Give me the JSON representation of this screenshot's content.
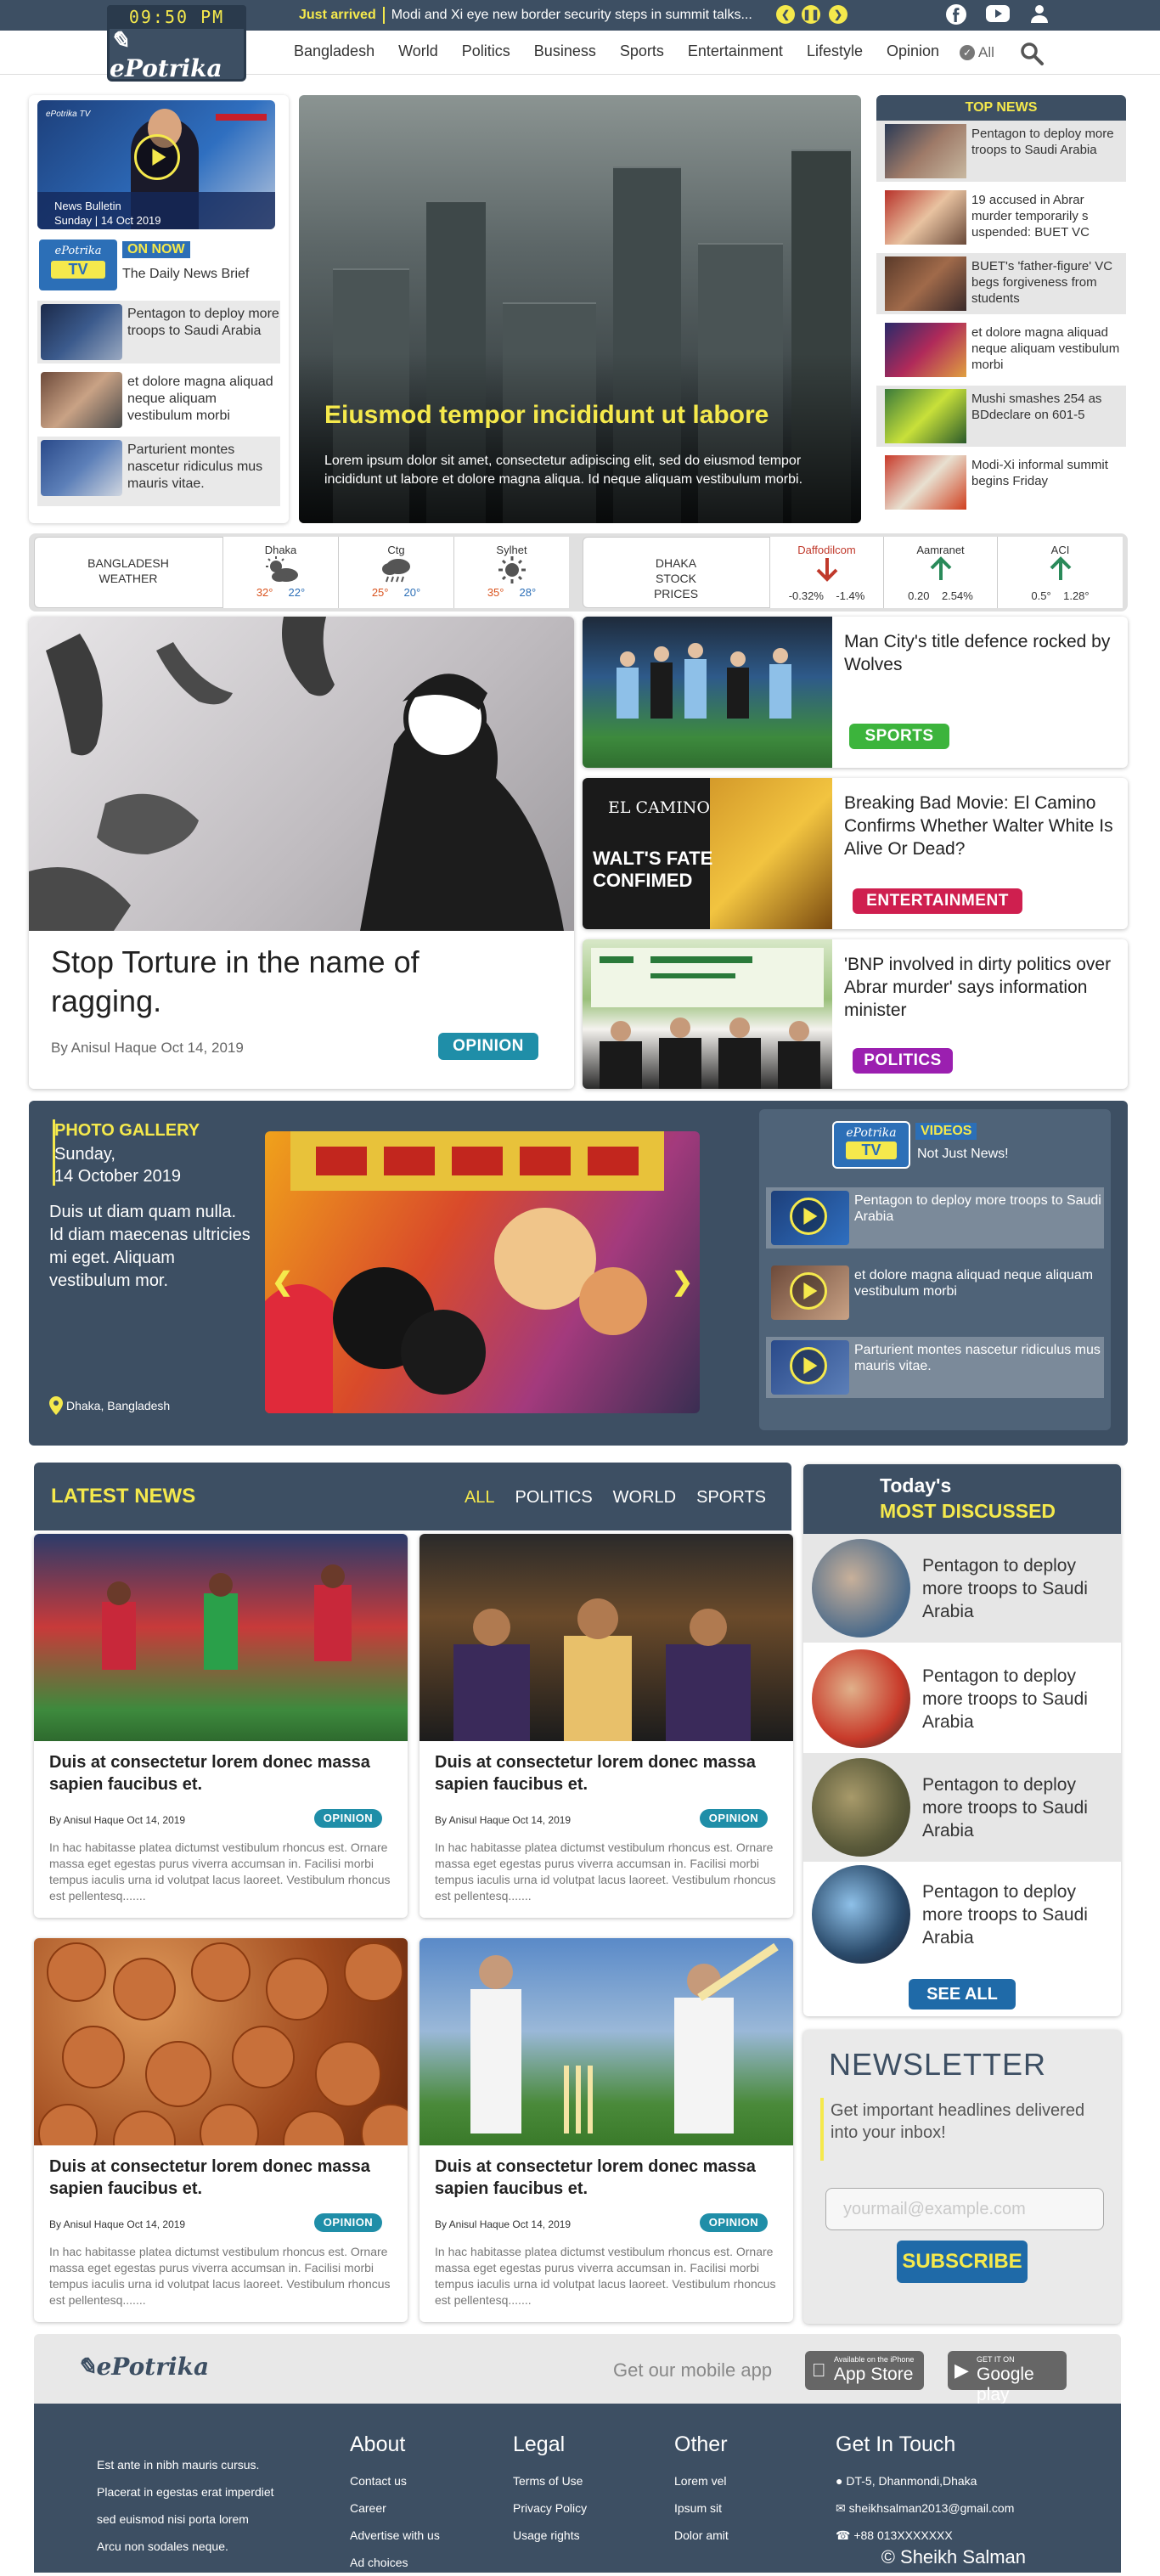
{
  "clock": "09:50 PM",
  "brand": "ePotrika",
  "ticker": {
    "label": "Just arrived",
    "text": "Modi and Xi eye new border security steps in summit talks..."
  },
  "nav": [
    "Bangladesh",
    "World",
    "Politics",
    "Business",
    "Sports",
    "Entertainment",
    "Lifestyle",
    "Opinion"
  ],
  "nav_all": "All",
  "tv": {
    "caption1": "News Bulletin",
    "caption2": "Sunday | 14 Oct 2019",
    "logo_small": "ePotrika TV",
    "badge_l1": "ePotrika",
    "badge_l2": "TV",
    "on_now": "ON NOW",
    "brief": "The Daily News Brief"
  },
  "left_stories": [
    "Pentagon to deploy more troops to Saudi Arabia",
    "et dolore magna aliquad neque aliquam vestibulum morbi",
    "Parturient montes nascetur ridiculus mus mauris vitae."
  ],
  "hero": {
    "title": "Eiusmod tempor incididunt ut labore",
    "desc": "Lorem ipsum dolor sit amet, consectetur adipiscing elit, sed do eiusmod tempor incididunt ut labore et dolore magna aliqua. Id neque aliquam vestibulum morbi."
  },
  "top_news": {
    "heading": "TOP NEWS",
    "items": [
      "Pentagon to deploy more troops to Saudi Arabia",
      "19 accused in Abrar murder temporarily s uspended: BUET VC",
      "BUET's 'father-figure' VC begs forgiveness from students",
      "et dolore magna aliquad neque aliquam vestibulum morbi",
      "Mushi smashes 254 as BDdeclare on 601-5",
      "Modi-Xi informal summit begins Friday"
    ]
  },
  "weather": {
    "label": "BANGLADESH WEATHER",
    "cities": [
      {
        "name": "Dhaka",
        "hi": "32°",
        "lo": "22°",
        "icon": "cloud-sun-icon"
      },
      {
        "name": "Ctg",
        "hi": "25°",
        "lo": "20°",
        "icon": "rain-cloud-icon"
      },
      {
        "name": "Sylhet",
        "hi": "35°",
        "lo": "28°",
        "icon": "sun-icon"
      }
    ]
  },
  "stocks": {
    "label": "DHAKA STOCK PRICES",
    "items": [
      {
        "name": "Daffodilcom",
        "change": "-0.32%",
        "pct": "-1.4%",
        "dir": "down",
        "color": "#c0392b"
      },
      {
        "name": "Aamranet",
        "change": "0.20",
        "pct": "2.54%",
        "dir": "up",
        "color": "#2a8a5a"
      },
      {
        "name": "ACI",
        "change": "0.5°",
        "pct": "1.28°",
        "dir": "up",
        "color": "#2a8a5a"
      }
    ]
  },
  "feature": {
    "title": "Stop Torture in the name of ragging.",
    "byline": "By Anisul Haque Oct 14, 2019",
    "tag": "OPINION"
  },
  "side_cards": [
    {
      "title": "Man City's title defence rocked by Wolves",
      "tag": "SPORTS"
    },
    {
      "title": "Breaking Bad Movie: El Camino Confirms Whether Walter White Is Alive Or Dead?",
      "tag": "ENTERTAINMENT"
    },
    {
      "title": "'BNP involved in dirty politics over Abrar murder' says information minister",
      "tag": "POLITICS"
    }
  ],
  "elcamino": {
    "l1": "EL CAMINO",
    "l2": "WALT'S FATE",
    "l3": "CONFIMED"
  },
  "gallery": {
    "heading": "PHOTO GALLERY",
    "date1": "Sunday,",
    "date2": "14 October 2019",
    "desc": "Duis ut diam quam nulla. Id diam maecenas ultricies mi eget. Aliquam vestibulum mor.",
    "location": "Dhaka, Bangladesh"
  },
  "videos": {
    "logo1": "ePotrika",
    "logo2": "TV",
    "heading": "VIDEOS",
    "sub": "Not Just News!",
    "items": [
      "Pentagon to deploy more troops to Saudi Arabia",
      "et dolore magna aliquad neque aliquam vestibulum morbi",
      "Parturient montes nascetur ridiculus mus mauris vitae."
    ]
  },
  "latest": {
    "heading": "LATEST NEWS",
    "tabs": [
      "ALL",
      "POLITICS",
      "WORLD",
      "SPORTS"
    ],
    "cards": [
      {
        "title": "Duis at consectetur lorem donec massa sapien faucibus et.",
        "byline": "By Anisul Haque Oct 14, 2019",
        "tag": "OPINION",
        "excerpt": "In hac habitasse platea dictumst vestibulum rhoncus est. Ornare massa eget egestas purus viverra accumsan in. Facilisi morbi tempus iaculis urna id volutpat lacus laoreet. Vestibulum rhoncus est pellentesq......."
      },
      {
        "title": "Duis at consectetur lorem donec massa sapien faucibus et.",
        "byline": "By Anisul Haque Oct 14, 2019",
        "tag": "OPINION",
        "excerpt": "In hac habitasse platea dictumst vestibulum rhoncus est. Ornare massa eget egestas purus viverra accumsan in. Facilisi morbi tempus iaculis urna id volutpat lacus laoreet. Vestibulum rhoncus est pellentesq......."
      },
      {
        "title": "Duis at consectetur lorem donec massa sapien faucibus et.",
        "byline": "By Anisul Haque Oct 14, 2019",
        "tag": "OPINION",
        "excerpt": "In hac habitasse platea dictumst vestibulum rhoncus est. Ornare massa eget egestas purus viverra accumsan in. Facilisi morbi tempus iaculis urna id volutpat lacus laoreet. Vestibulum rhoncus est pellentesq......."
      },
      {
        "title": "Duis at consectetur lorem donec massa sapien faucibus et.",
        "byline": "By Anisul Haque Oct 14, 2019",
        "tag": "OPINION",
        "excerpt": "In hac habitasse platea dictumst vestibulum rhoncus est. Ornare massa eget egestas purus viverra accumsan in. Facilisi morbi tempus iaculis urna id volutpat lacus laoreet. Vestibulum rhoncus est pellentesq......."
      }
    ]
  },
  "most_discussed": {
    "l1": "Today's",
    "l2": "MOST DISCUSSED",
    "items": [
      "Pentagon to deploy more troops to Saudi Arabia",
      "Pentagon to deploy more troops to Saudi Arabia",
      "Pentagon to deploy more troops to Saudi Arabia",
      "Pentagon to deploy more troops to Saudi Arabia"
    ],
    "see_all": "SEE ALL"
  },
  "newsletter": {
    "title": "NEWSLETTER",
    "sub": "Get important headlines delivered into your inbox!",
    "placeholder": "yourmail@example.com",
    "button": "SUBSCRIBE"
  },
  "app": {
    "get": "Get our mobile app",
    "appstore_small": "Available on the iPhone",
    "appstore_big": "App Store",
    "gplay_small": "GET IT ON",
    "gplay_big": "Google play"
  },
  "footer": {
    "blurb": [
      "Est ante in nibh mauris cursus.",
      "Placerat in egestas erat imperdiet",
      "sed euismod nisi porta lorem",
      "Arcu non sodales neque."
    ],
    "about": {
      "h": "About",
      "items": [
        "Contact us",
        "Career",
        "Advertise with us",
        "Ad choices"
      ]
    },
    "legal": {
      "h": "Legal",
      "items": [
        "Terms of Use",
        "Privacy Policy",
        "Usage rights"
      ]
    },
    "other": {
      "h": "Other",
      "items": [
        "Lorem vel",
        "Ipsum sit",
        "Dolor amit"
      ]
    },
    "contact": {
      "h": "Get In Touch",
      "items": [
        "DT-5, Dhanmondi,Dhaka",
        "sheikhsalman2013@gmail.com",
        "+88 013XXXXXXX"
      ]
    },
    "copyright": "© Sheikh Salman"
  },
  "colors": {
    "primary": "#3d4f63",
    "accent": "#f5e94c",
    "opinion": "#1f8ea8",
    "sports": "#3cb43c",
    "entertainment": "#cf1f4f",
    "politics": "#9b1fb0",
    "button": "#1f6aa8"
  }
}
